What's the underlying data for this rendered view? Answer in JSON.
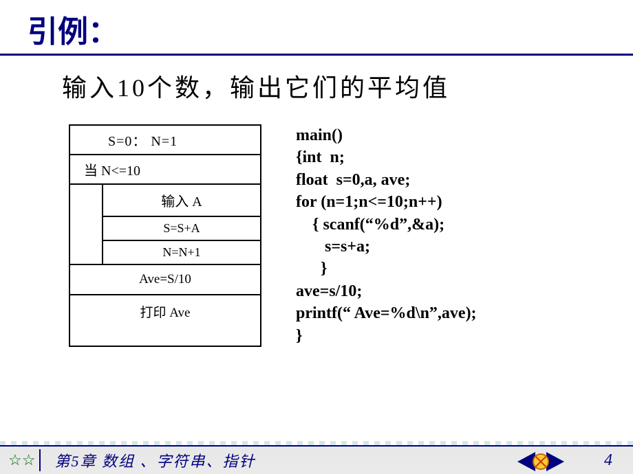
{
  "header": {
    "title": "引例："
  },
  "subtitle": "输入10个数，输出它们的平均值",
  "flowchart": {
    "init": "S=0：  N=1",
    "cond": "当 N<=10",
    "body": [
      "输入 A",
      "S=S+A",
      "N=N+1"
    ],
    "post": "Ave=S/10",
    "last": "打印 Ave"
  },
  "code": "main()\n{int  n;\nfloat  s=0,a, ave;\nfor (n=1;n<=10;n++)\n    { scanf(“%d”,&a);\n       s=s+a;\n      }\nave=s/10;\nprintf(“ Ave=%d\\n”,ave);\n}",
  "footer": {
    "stars": "☆☆",
    "chapter": "第5章   数组 、字符串、指针",
    "page": "4"
  }
}
